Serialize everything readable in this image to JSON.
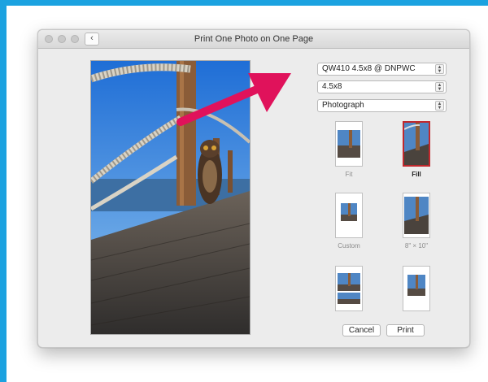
{
  "window": {
    "title": "Print One Photo on One Page",
    "back_glyph": "‹"
  },
  "printer_select": {
    "value": "QW410 4.5x8 @ DNPWC"
  },
  "paper_select": {
    "value": "4.5x8"
  },
  "type_select": {
    "value": "Photograph"
  },
  "layouts": [
    {
      "label": "Fit",
      "selected": false
    },
    {
      "label": "Fill",
      "selected": true
    },
    {
      "label": "Custom",
      "selected": false
    },
    {
      "label": "8\" × 10\"",
      "selected": false
    },
    {
      "label": "",
      "selected": false
    },
    {
      "label": "",
      "selected": false
    }
  ],
  "buttons": {
    "cancel": "Cancel",
    "print": "Print"
  },
  "colors": {
    "frame": "#1ba2e0",
    "arrow": "#e0125b",
    "selection": "#c0282d"
  }
}
